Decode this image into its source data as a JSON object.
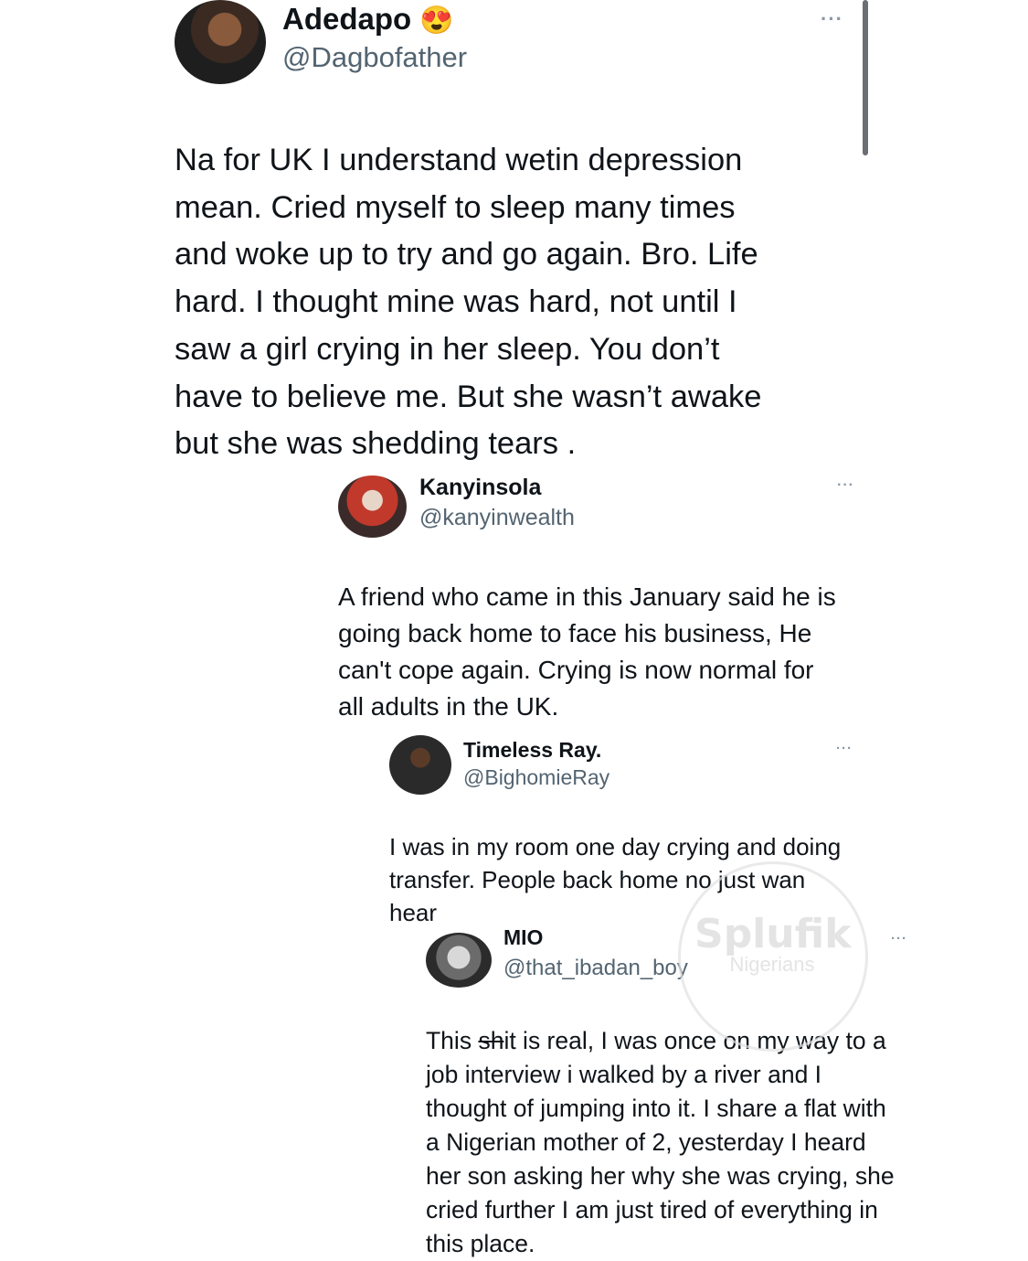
{
  "watermark": {
    "title": "Splufik",
    "subtitle": "Nigerians"
  },
  "tweets": [
    {
      "name": "Adedapo",
      "emoji": "😍",
      "handle": "@Dagbofather",
      "more": "···",
      "text": "Na for UK I understand wetin depression\nmean. Cried myself to sleep many times\nand woke up to try and go again. Bro. Life\nhard. I thought mine was hard, not until I\nsaw a girl crying in her sleep. You don’t\nhave to believe me. But she wasn’t awake\nbut she was shedding tears ."
    },
    {
      "name": "Kanyinsola",
      "handle": "@kanyinwealth",
      "more": "···",
      "text": "A friend who came in this January said he is\ngoing back home to face his business, He\ncan't cope again. Crying is now normal for\nall adults in the UK."
    },
    {
      "name": "Timeless Ray.",
      "handle": "@BighomieRay",
      "more": "···",
      "text": "I was in my room one day crying and doing\ntransfer. People back home no just wan\nhear"
    },
    {
      "name": "MIO",
      "handle": "@that_ibadan_boy",
      "more": "···",
      "text_pre": "This ",
      "text_strike": "sh",
      "text_post": "it is real, I was once on my way to a\njob interview i walked by a river and I\nthought of jumping into it. I share a flat with\na Nigerian mother of 2, yesterday I heard\nher son asking her why she was crying, she\ncried further I am just tired of everything in\nthis place."
    }
  ],
  "colors": {
    "text": "#0f1419",
    "secondary": "#536471",
    "more": "#8b98a5"
  }
}
